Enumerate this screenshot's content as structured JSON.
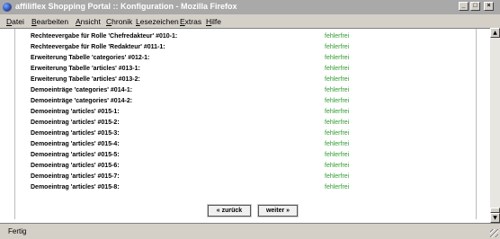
{
  "window": {
    "title": "affiliflex Shopping Portal :: Konfiguration - Mozilla Firefox",
    "min_glyph": "_",
    "max_glyph": "□",
    "close_glyph": "×"
  },
  "menu": {
    "items": [
      "Datei",
      "Bearbeiten",
      "Ansicht",
      "Chronik",
      "Lesezeichen",
      "Extras",
      "Hilfe"
    ]
  },
  "rows": [
    {
      "label": "Rechteevergabe für Rolle 'Chefredakteur' #010-1:",
      "status": "fehlerfrei"
    },
    {
      "label": "Rechteevergabe für Rolle 'Redakteur' #011-1:",
      "status": "fehlerfrei"
    },
    {
      "label": "Erweiterung Tabelle 'categories' #012-1:",
      "status": "fehlerfrei"
    },
    {
      "label": "Erweiterung Tabelle 'articles' #013-1:",
      "status": "fehlerfrei"
    },
    {
      "label": "Erweiterung Tabelle 'articles' #013-2:",
      "status": "fehlerfrei"
    },
    {
      "label": "Demoeinträge 'categories' #014-1:",
      "status": "fehlerfrei"
    },
    {
      "label": "Demoeinträge 'categories' #014-2:",
      "status": "fehlerfrei"
    },
    {
      "label": "Demoeintrag 'articles' #015-1:",
      "status": "fehlerfrei"
    },
    {
      "label": "Demoeintrag 'articles' #015-2:",
      "status": "fehlerfrei"
    },
    {
      "label": "Demoeintrag 'articles' #015-3:",
      "status": "fehlerfrei"
    },
    {
      "label": "Demoeintrag 'articles' #015-4:",
      "status": "fehlerfrei"
    },
    {
      "label": "Demoeintrag 'articles' #015-5:",
      "status": "fehlerfrei"
    },
    {
      "label": "Demoeintrag 'articles' #015-6:",
      "status": "fehlerfrei"
    },
    {
      "label": "Demoeintrag 'articles' #015-7:",
      "status": "fehlerfrei"
    },
    {
      "label": "Demoeintrag 'articles' #015-8:",
      "status": "fehlerfrei"
    }
  ],
  "buttons": {
    "back_label": "« zurück",
    "next_label": "weiter »"
  },
  "statusbar": {
    "text": "Fertig"
  },
  "colors": {
    "status_ok": "#2f9b2f"
  },
  "icons": {
    "app": "firefox-icon",
    "scroll_up": "scroll-up-arrow-icon",
    "scroll_down": "scroll-down-arrow-icon"
  }
}
